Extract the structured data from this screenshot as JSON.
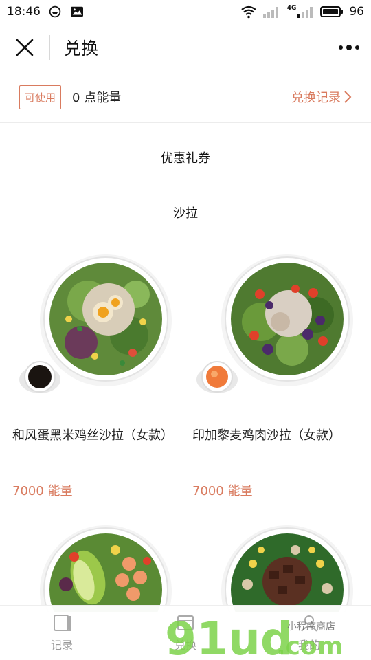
{
  "status_bar": {
    "time": "18:46",
    "network": "4G",
    "battery": "96"
  },
  "nav": {
    "title": "兑换"
  },
  "points": {
    "badge": "可使用",
    "text": "0 点能量",
    "history_label": "兑换记录"
  },
  "sections": {
    "coupons": "优惠礼券",
    "salad": "沙拉"
  },
  "products": [
    {
      "name": "和风蛋黑米鸡丝沙拉（女款）",
      "price": "7000 能量"
    },
    {
      "name": "印加黎麦鸡肉沙拉（女款）",
      "price": "7000 能量"
    }
  ],
  "tabs": [
    {
      "label": "记录"
    },
    {
      "label": "兑换"
    },
    {
      "label": "我的"
    }
  ],
  "watermark": {
    "brand": "91ud",
    "tld": ".com",
    "tagline": "小程序商店"
  },
  "colors": {
    "accent": "#d97b5f",
    "watermark_green": "#7dd24a"
  }
}
